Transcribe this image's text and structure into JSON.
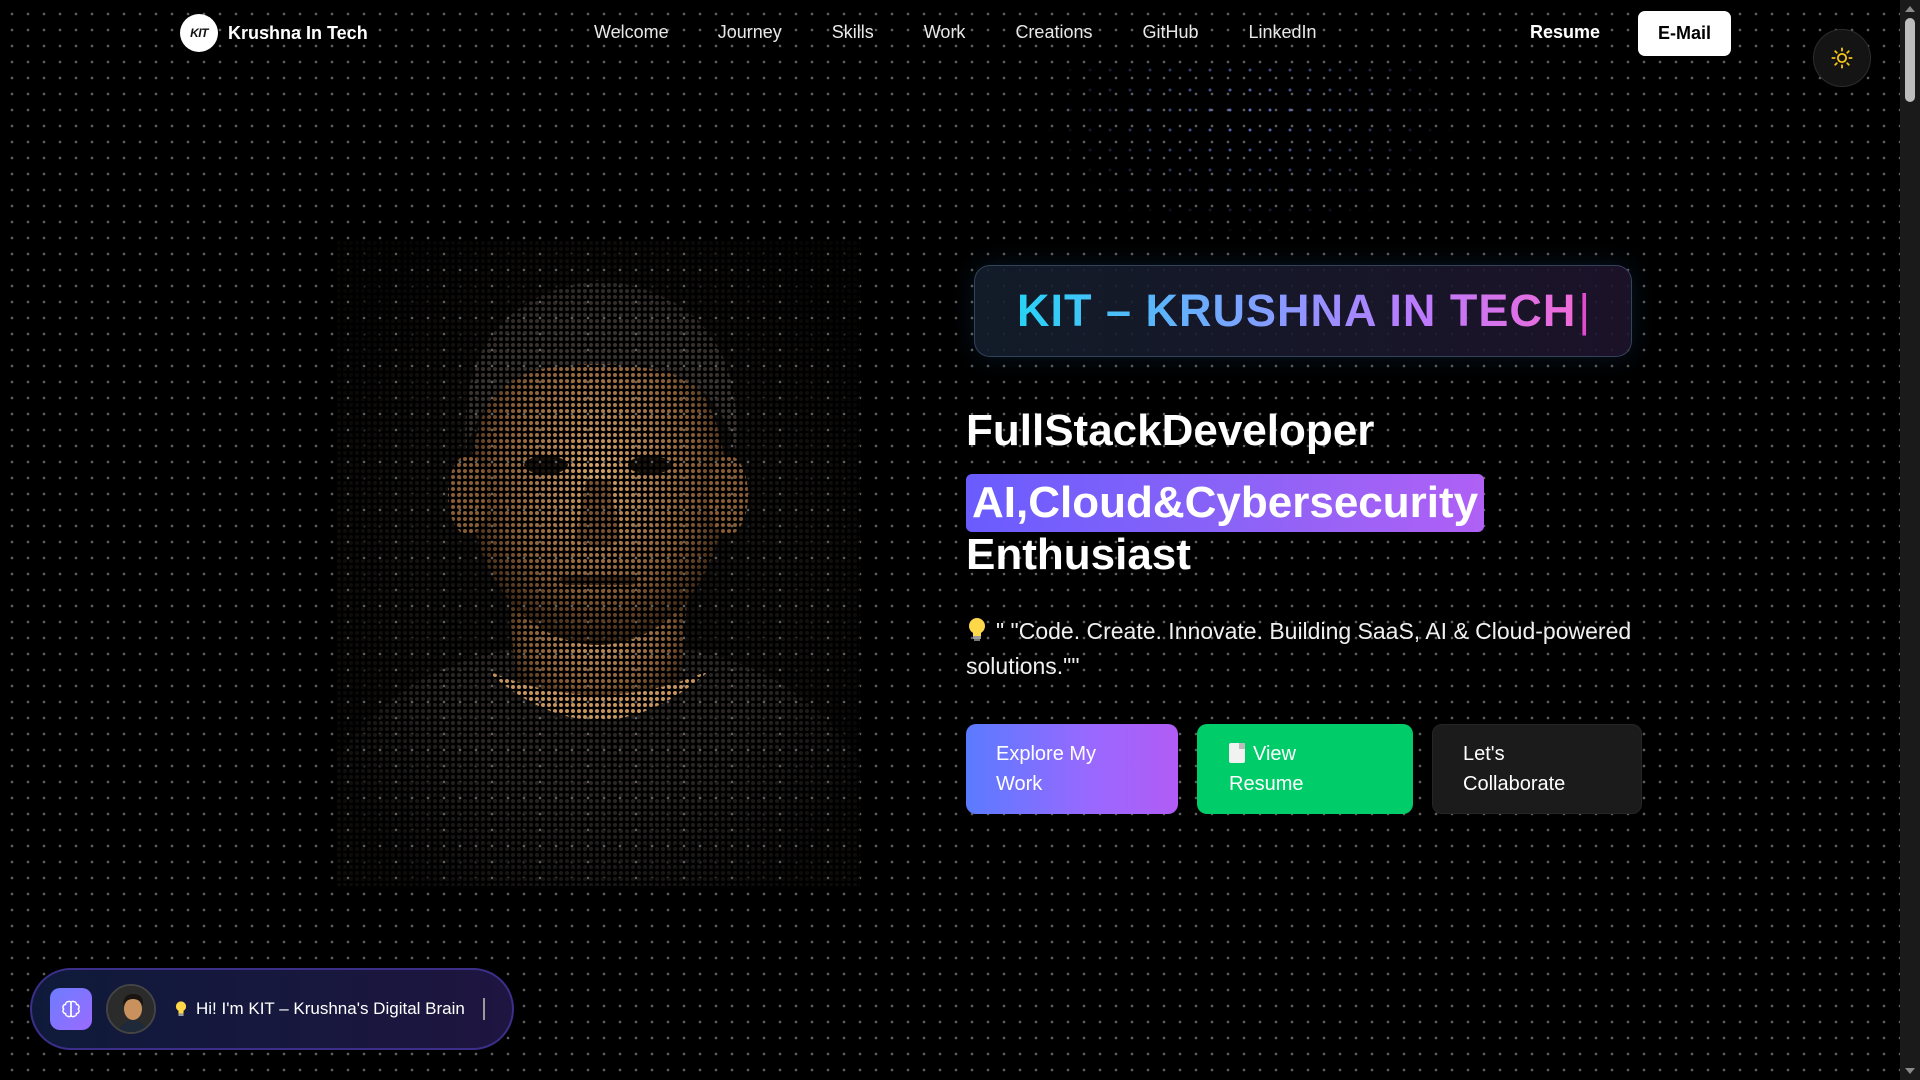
{
  "nav": {
    "logo_badge": "KIT",
    "logo_text": "Krushna In Tech",
    "links": [
      {
        "label": "Welcome"
      },
      {
        "label": "Journey"
      },
      {
        "label": "Skills"
      },
      {
        "label": "Work"
      },
      {
        "label": "Creations"
      },
      {
        "label": "GitHub"
      },
      {
        "label": "LinkedIn"
      }
    ],
    "resume_label": "Resume",
    "email_label": "E-Mail",
    "theme_icon": "sun-icon"
  },
  "hero": {
    "banner": "KIT – KRUSHNA IN TECH",
    "line1": "FullStackDeveloper",
    "line2": "AI,Cloud&Cybersecurity",
    "line3": "Enthusiast",
    "quote": "\" \"Code. Create. Innovate. Building SaaS, AI & Cloud-powered solutions.\"\"",
    "quote_icon": "lightbulb-icon",
    "buttons": {
      "explore": "Explore My Work",
      "resume": "View Resume",
      "collaborate": "Let's Collaborate"
    }
  },
  "chat": {
    "message": "Hi! I'm KIT – Krushna's Digital Brain",
    "ai_icon": "brain-icon"
  },
  "colors": {
    "accent_purple": "#8a63f7",
    "accent_green": "#00cc6a",
    "accent_cyan": "#27d3f5"
  }
}
